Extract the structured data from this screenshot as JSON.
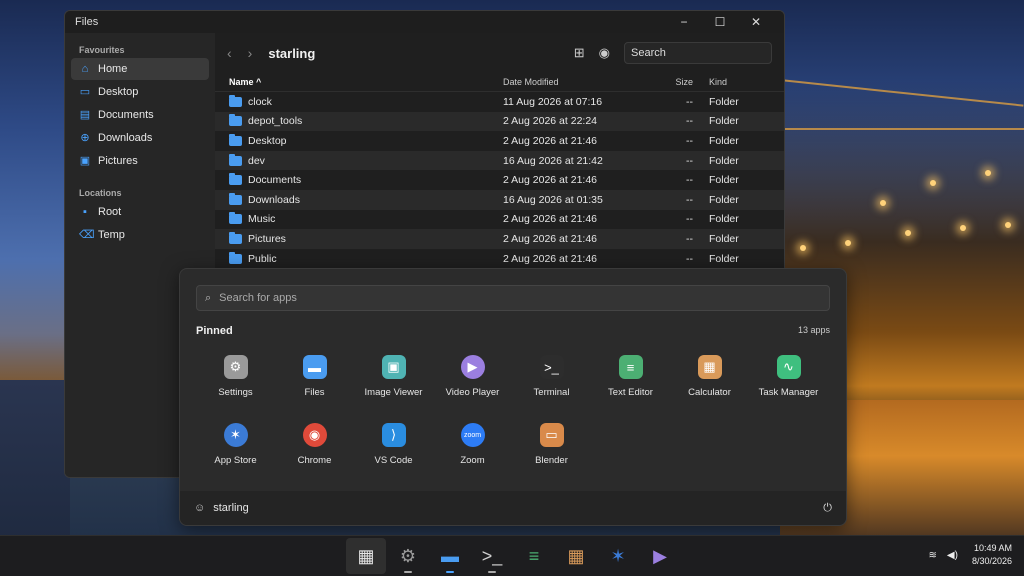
{
  "files_window": {
    "title": "Files",
    "controls": {
      "minimize": "−",
      "maximize": "☐",
      "close": "✕"
    },
    "sidebar": {
      "favourites_title": "Favourites",
      "favourites": [
        {
          "label": "Home",
          "icon": "home-icon"
        },
        {
          "label": "Desktop",
          "icon": "desktop-icon"
        },
        {
          "label": "Documents",
          "icon": "documents-icon"
        },
        {
          "label": "Downloads",
          "icon": "downloads-icon"
        },
        {
          "label": "Pictures",
          "icon": "pictures-icon"
        }
      ],
      "locations_title": "Locations",
      "locations": [
        {
          "label": "Root",
          "icon": "drive-icon"
        },
        {
          "label": "Temp",
          "icon": "trash-icon"
        }
      ]
    },
    "path": "starling",
    "search_placeholder": "Search",
    "columns": {
      "name": "Name ^",
      "date": "Date Modified",
      "size": "Size",
      "kind": "Kind"
    },
    "rows": [
      {
        "name": "clock",
        "date": "11 Aug 2026 at 07:16",
        "size": "--",
        "kind": "Folder"
      },
      {
        "name": "depot_tools",
        "date": "2 Aug 2026 at 22:24",
        "size": "--",
        "kind": "Folder"
      },
      {
        "name": "Desktop",
        "date": "2 Aug 2026 at 21:46",
        "size": "--",
        "kind": "Folder"
      },
      {
        "name": "dev",
        "date": "16 Aug 2026 at 21:42",
        "size": "--",
        "kind": "Folder"
      },
      {
        "name": "Documents",
        "date": "2 Aug 2026 at 21:46",
        "size": "--",
        "kind": "Folder"
      },
      {
        "name": "Downloads",
        "date": "16 Aug 2026 at 01:35",
        "size": "--",
        "kind": "Folder"
      },
      {
        "name": "Music",
        "date": "2 Aug 2026 at 21:46",
        "size": "--",
        "kind": "Folder"
      },
      {
        "name": "Pictures",
        "date": "2 Aug 2026 at 21:46",
        "size": "--",
        "kind": "Folder"
      },
      {
        "name": "Public",
        "date": "2 Aug 2026 at 21:46",
        "size": "--",
        "kind": "Folder"
      }
    ]
  },
  "start_menu": {
    "search_placeholder": "Search for apps",
    "pinned_title": "Pinned",
    "pinned_count": "13 apps",
    "apps": [
      {
        "label": "Settings",
        "icon": "gear-icon",
        "glyph": "⚙",
        "color": "#9a9a9a"
      },
      {
        "label": "Files",
        "icon": "folder-icon",
        "glyph": "▬",
        "color": "#4a9cf0"
      },
      {
        "label": "Image Viewer",
        "icon": "image-icon",
        "glyph": "▣",
        "color": "#4fb3b3"
      },
      {
        "label": "Video Player",
        "icon": "play-icon",
        "glyph": "▶",
        "color": "#9b7fe0"
      },
      {
        "label": "Terminal",
        "icon": "terminal-icon",
        "glyph": ">_",
        "color": "#2d2d2d"
      },
      {
        "label": "Text Editor",
        "icon": "text-editor-icon",
        "glyph": "≡",
        "color": "#4caf73"
      },
      {
        "label": "Calculator",
        "icon": "calculator-icon",
        "glyph": "▦",
        "color": "#d99a5a"
      },
      {
        "label": "Task Manager",
        "icon": "activity-icon",
        "glyph": "∿",
        "color": "#3fbf7f"
      },
      {
        "label": "App Store",
        "icon": "app-store-icon",
        "glyph": "✶",
        "color": "#3b7bd6"
      },
      {
        "label": "Chrome",
        "icon": "chrome-icon",
        "glyph": "◉",
        "color": "#e04a3a"
      },
      {
        "label": "VS Code",
        "icon": "vscode-icon",
        "glyph": "⟩",
        "color": "#2a8de0"
      },
      {
        "label": "Zoom",
        "icon": "zoom-icon",
        "glyph": "zoom",
        "color": "#2d7cf5"
      },
      {
        "label": "Blender",
        "icon": "blender-icon",
        "glyph": "▭",
        "color": "#d98a4a"
      }
    ],
    "user": "starling"
  },
  "taskbar": {
    "items": [
      {
        "icon": "launcher-icon",
        "glyph": "▦",
        "color": "#e6e6e6",
        "active": true,
        "dot": ""
      },
      {
        "icon": "gear-icon",
        "glyph": "⚙",
        "color": "#9a9a9a",
        "active": false,
        "dot": "grey"
      },
      {
        "icon": "folder-icon",
        "glyph": "▬",
        "color": "#4a9cf0",
        "active": false,
        "dot": "blue"
      },
      {
        "icon": "terminal-icon",
        "glyph": ">_",
        "color": "#d0d0d0",
        "active": false,
        "dot": "grey"
      },
      {
        "icon": "text-editor-icon",
        "glyph": "≡",
        "color": "#4caf73",
        "active": false,
        "dot": ""
      },
      {
        "icon": "calculator-icon",
        "glyph": "▦",
        "color": "#d99a5a",
        "active": false,
        "dot": ""
      },
      {
        "icon": "app-store-icon",
        "glyph": "✶",
        "color": "#3b7bd6",
        "active": false,
        "dot": ""
      },
      {
        "icon": "play-icon",
        "glyph": "▶",
        "color": "#9b7fe0",
        "active": false,
        "dot": ""
      }
    ],
    "time": "10:49 AM",
    "date": "8/30/2026"
  }
}
